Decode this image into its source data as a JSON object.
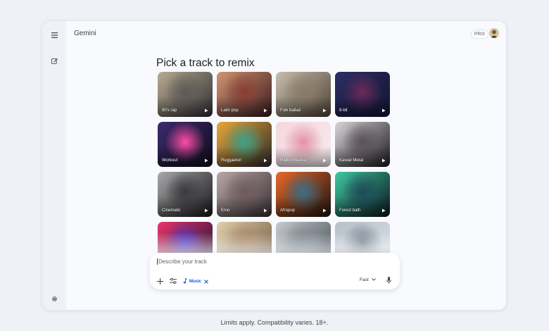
{
  "app": {
    "title": "Gemini",
    "pro_badge": "PRO"
  },
  "rail": {
    "menu_icon": "menu-icon",
    "new_chat_icon": "edit-icon",
    "settings_icon": "gear-icon"
  },
  "main": {
    "heading": "Pick a track to remix"
  },
  "tracks": [
    {
      "label": "90's rap",
      "colors": [
        "#b9ab93",
        "#5e5a55",
        "#2f2f32"
      ]
    },
    {
      "label": "Latin pop",
      "colors": [
        "#d29572",
        "#8a3e34",
        "#3a1a1f"
      ]
    },
    {
      "label": "Folk ballad",
      "colors": [
        "#c9bfad",
        "#8a7b66",
        "#4e4438"
      ]
    },
    {
      "label": "8-bit",
      "colors": [
        "#2b2e63",
        "#6b2a5a",
        "#131533"
      ]
    },
    {
      "label": "Workout",
      "colors": [
        "#3d2a6e",
        "#ff4da6",
        "#0d0d1a"
      ]
    },
    {
      "label": "Reggaeton",
      "colors": [
        "#e9a83a",
        "#3aa38a",
        "#2a2a2a"
      ]
    },
    {
      "label": "R&B romance",
      "colors": [
        "#f6d7de",
        "#e58fa5",
        "#f5ecef"
      ]
    },
    {
      "label": "Kawaii Metal",
      "colors": [
        "#d9d5d8",
        "#5a5058",
        "#1c1a1f"
      ]
    },
    {
      "label": "Cinematic",
      "colors": [
        "#a9a9ab",
        "#3a3a3d",
        "#151517"
      ]
    },
    {
      "label": "Emo",
      "colors": [
        "#b9a7a6",
        "#6f5b5e",
        "#3a3034"
      ]
    },
    {
      "label": "Afropop",
      "colors": [
        "#e8692a",
        "#3a6e8a",
        "#1a1612"
      ]
    },
    {
      "label": "Forest bath",
      "colors": [
        "#3ec9a0",
        "#1e4a5a",
        "#0c1620"
      ]
    },
    {
      "label": "",
      "colors": [
        "#e8346b",
        "#4a38c9",
        "#1a1030"
      ]
    },
    {
      "label": "",
      "colors": [
        "#e3cfae",
        "#a8865f",
        "#6a5238"
      ]
    },
    {
      "label": "",
      "colors": [
        "#c8ccd0",
        "#7d868e",
        "#3e464e"
      ]
    },
    {
      "label": "",
      "colors": [
        "#b8c0c8",
        "#6f7d88",
        "#d9dde2"
      ]
    }
  ],
  "composer": {
    "placeholder": "Describe your track",
    "add_icon": "plus-icon",
    "tools_icon": "tools-icon",
    "chip_label": "Music",
    "chip_icon": "music-note-icon",
    "mode_label": "Fast",
    "mic_icon": "mic-icon"
  },
  "footer": {
    "text": "Limits apply. Compatibility varies. 18+."
  },
  "colors": {
    "accent": "#0b57d0",
    "background": "#eef1f6",
    "surface": "#f8fafd"
  }
}
